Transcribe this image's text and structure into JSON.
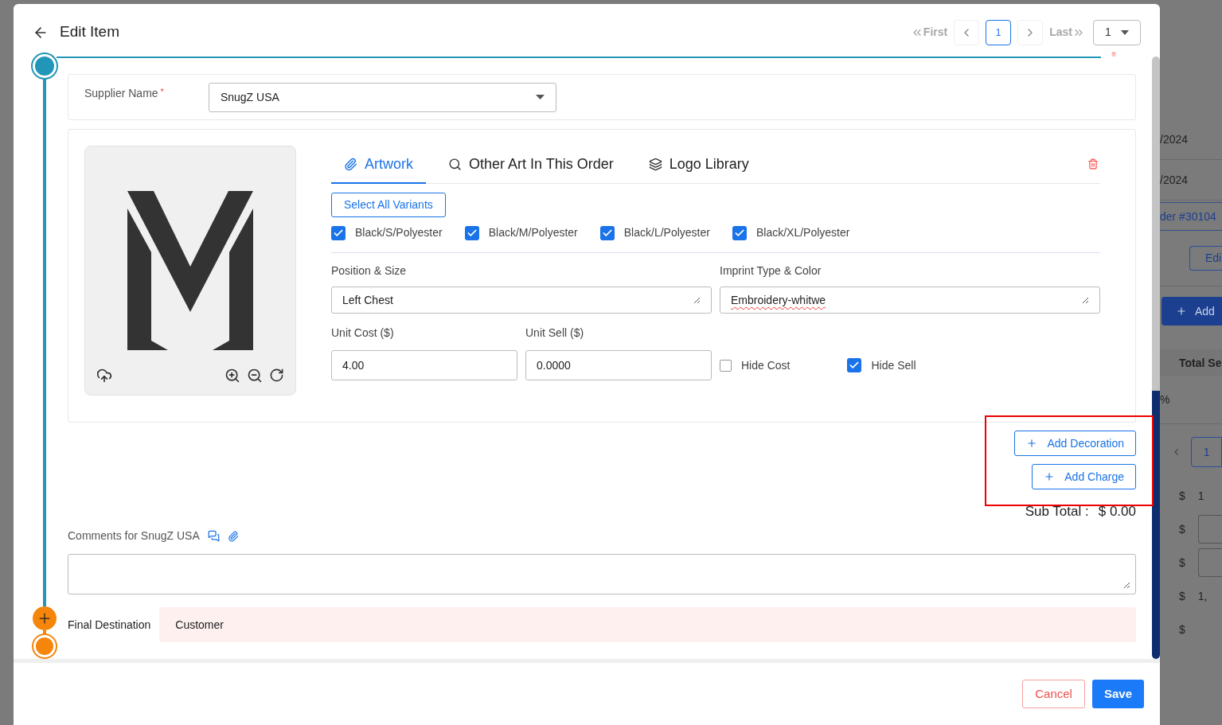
{
  "background_page": {
    "dates": [
      "/2024",
      "/2024"
    ],
    "order_link": "der #30104",
    "edit_button": "Edi",
    "add_button": "Add",
    "column_header": "Total Se",
    "percent": "%",
    "page_button": "1",
    "currency_rows": [
      {
        "kind": "text",
        "symbol": "$",
        "value": "1"
      },
      {
        "kind": "field",
        "symbol": "$"
      },
      {
        "kind": "field",
        "symbol": "$"
      },
      {
        "kind": "text",
        "symbol": "$",
        "value": "1,"
      },
      {
        "kind": "text",
        "symbol": "$"
      }
    ]
  },
  "dialog": {
    "title": "Edit Item",
    "pager": {
      "first": "First",
      "last": "Last",
      "pages": [
        {
          "label": "1",
          "selected": true
        }
      ],
      "page_select": "1"
    },
    "supplier": {
      "label": "Supplier Name",
      "required_mark": "*",
      "value": "SnugZ USA"
    },
    "decoration": {
      "tabs": [
        {
          "label": "Artwork",
          "selected": true
        },
        {
          "label": "Other Art In This Order",
          "selected": false
        },
        {
          "label": "Logo Library",
          "selected": false
        }
      ],
      "select_all": "Select All Variants",
      "variants": [
        {
          "label": "Black/S/Polyester",
          "checked": true
        },
        {
          "label": "Black/M/Polyester",
          "checked": true
        },
        {
          "label": "Black/L/Polyester",
          "checked": true
        },
        {
          "label": "Black/XL/Polyester",
          "checked": true
        }
      ],
      "position": {
        "label": "Position & Size",
        "value": "Left Chest"
      },
      "imprint": {
        "label": "Imprint Type & Color",
        "value": "Embroidery-whitwe"
      },
      "unit_cost": {
        "label": "Unit Cost ($)",
        "value": "4.00"
      },
      "unit_sell": {
        "label": "Unit Sell ($)",
        "value": "0.0000"
      },
      "options": [
        {
          "label": "Hide Cost",
          "checked": false
        },
        {
          "label": "Hide Sell",
          "checked": true
        }
      ]
    },
    "actions": [
      "Add Decoration",
      "Add Charge"
    ],
    "subtotal": {
      "label": "Sub Total :",
      "value": "$ 0.00"
    },
    "comments": {
      "label": "Comments for SnugZ USA"
    },
    "final_destination": {
      "label": "Final Destination",
      "value": "Customer"
    },
    "buttons": {
      "cancel": "Cancel",
      "save": "Save"
    }
  }
}
